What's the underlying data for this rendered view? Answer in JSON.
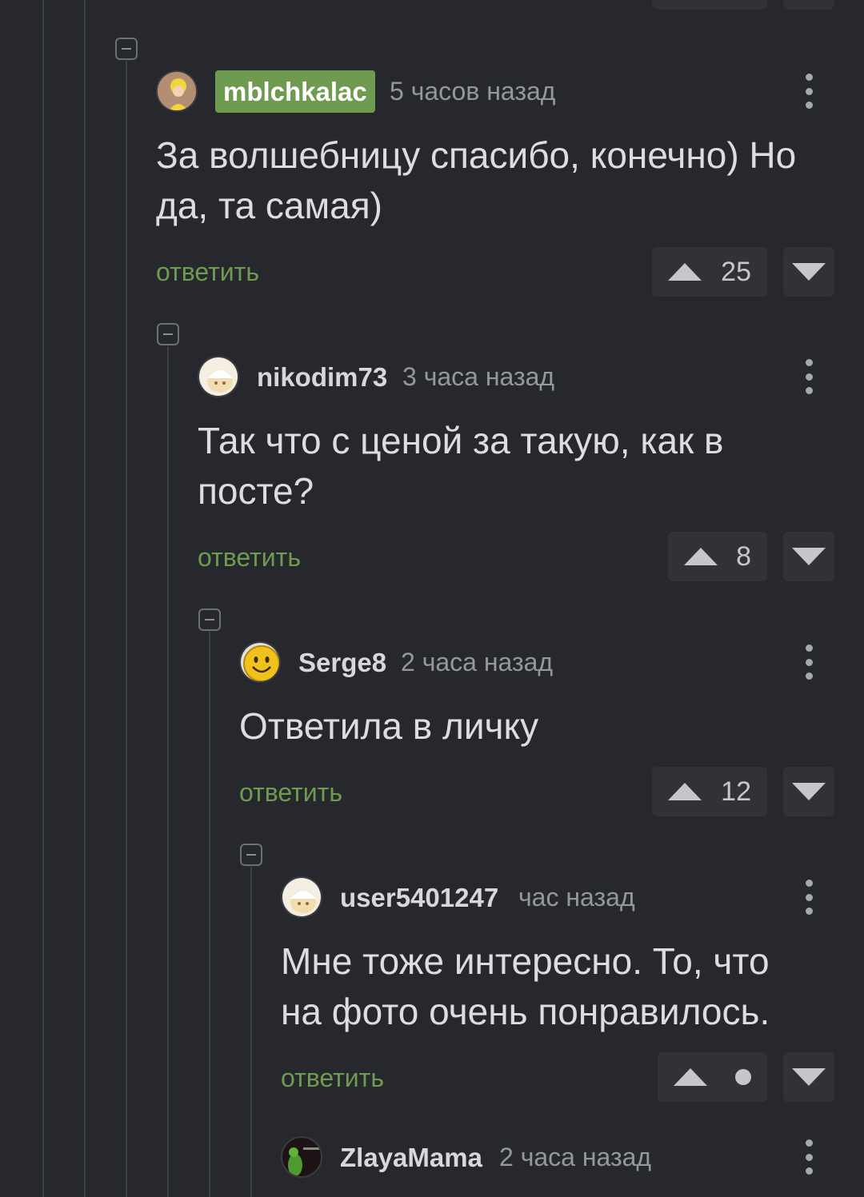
{
  "comments": [
    {
      "username": "mblchkalac",
      "time": "5 часов назад",
      "text_lines": [
        "За волшебницу спасибо, конечно) Но",
        "да, та самая)"
      ],
      "reply_label": "ответить",
      "score": "25"
    },
    {
      "username": "nikodim73",
      "time": "3 часа назад",
      "text_lines": [
        "Так что с ценой за такую, как в",
        "посте?"
      ],
      "reply_label": "ответить",
      "score": "8"
    },
    {
      "username": "Serge8",
      "time": "2 часа назад",
      "text_lines": [
        "Ответила в личку"
      ],
      "reply_label": "ответить",
      "score": "12"
    },
    {
      "username": "user5401247",
      "time": "час назад",
      "text_lines": [
        "Мне тоже интересно. То, что",
        "на фото очень понравилось."
      ],
      "reply_label": "ответить",
      "score": ""
    },
    {
      "username": "ZlayaMama",
      "time": "2 часа назад"
    }
  ],
  "colors": {
    "background": "#26282d",
    "accent_green": "#6e9b4f",
    "text": "#dcdde0",
    "muted": "#94979c"
  }
}
